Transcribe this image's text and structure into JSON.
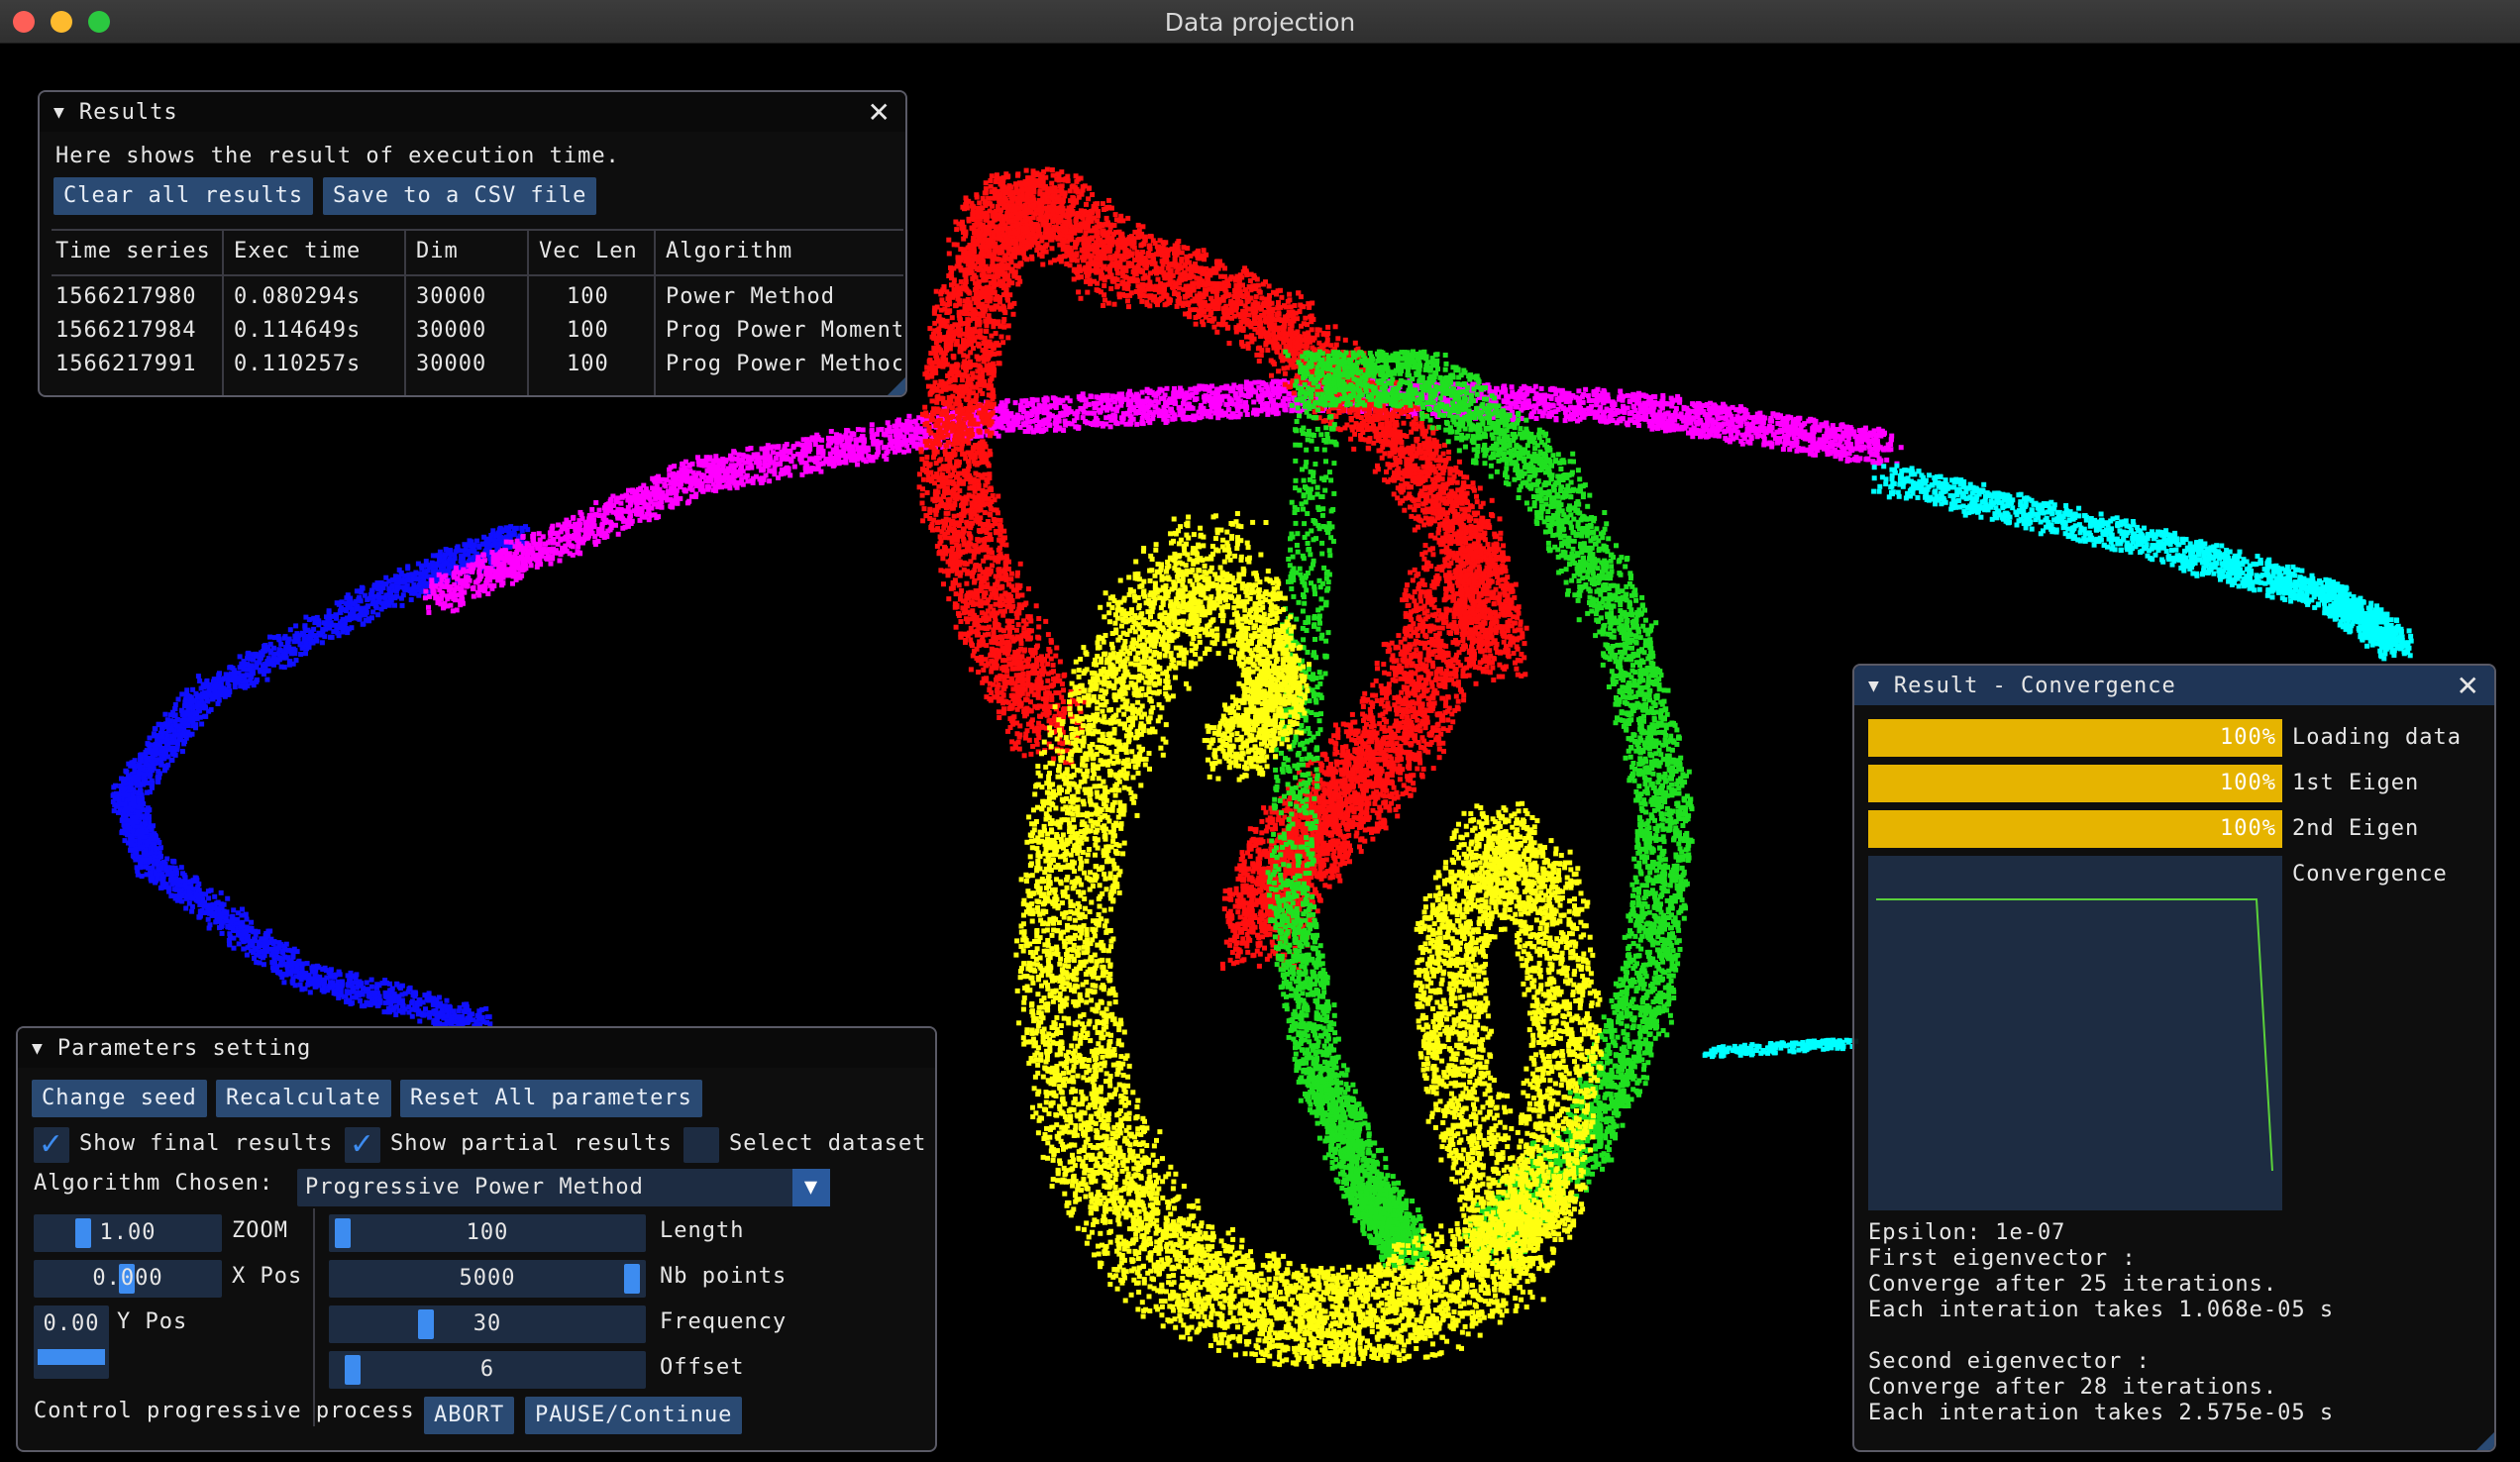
{
  "window": {
    "title": "Data projection"
  },
  "results": {
    "title": "Results",
    "description": "Here shows the result of execution time.",
    "clear_label": "Clear all results",
    "save_label": "Save to a CSV file",
    "columns": [
      "Time series",
      "Exec time",
      "Dim",
      "Vec Len",
      "Algorithm"
    ],
    "rows": [
      [
        "1566217980",
        "0.080294s",
        "30000",
        "100",
        "Power Method"
      ],
      [
        "1566217984",
        "0.114649s",
        "30000",
        "100",
        "Prog Power Moment"
      ],
      [
        "1566217991",
        "0.110257s",
        "30000",
        "100",
        "Prog Power Methoc"
      ]
    ]
  },
  "params": {
    "title": "Parameters setting",
    "change_seed": "Change seed",
    "recalculate": "Recalculate",
    "reset_all": "Reset All parameters",
    "show_final": "Show final results",
    "show_final_checked": true,
    "show_partial": "Show partial results",
    "show_partial_checked": true,
    "select_dataset": "Select dataset",
    "select_dataset_checked": false,
    "algorithm_label": "Algorithm Chosen:",
    "algorithm_value": "Progressive Power Method",
    "zoom_value": "1.00",
    "zoom_label": "ZOOM",
    "xpos_value": "0.000",
    "xpos_label": "X Pos",
    "ypos_value": "0.00",
    "ypos_label": "Y Pos",
    "length_value": "100",
    "length_label": "Length",
    "nbpoints_value": "5000",
    "nbpoints_label": "Nb points",
    "frequency_value": "30",
    "frequency_label": "Frequency",
    "offset_value": "6",
    "offset_label": "Offset",
    "control_label": "Control progressive process",
    "abort_label": "ABORT",
    "pause_label": "PAUSE/Continue"
  },
  "convergence": {
    "title": "Result - Convergence",
    "bars": [
      {
        "label": "Loading data",
        "text": "100%",
        "fraction": 1.0
      },
      {
        "label": "1st Eigen",
        "text": "100%",
        "fraction": 1.0
      },
      {
        "label": "2nd Eigen",
        "text": "100%",
        "fraction": 1.0
      }
    ],
    "plot_label": "Convergence",
    "lines": [
      "Epsilon: 1e-07",
      "First eigenvector :",
      "Converge after 25 iterations.",
      "Each interation takes 1.068e-05 s",
      "",
      "Second eigenvector :",
      "Converge after 28 iterations.",
      "Each interation takes 2.575e-05 s"
    ]
  },
  "colors": {
    "accent": "#3d8cf0",
    "button": "#2a4a73",
    "progress": "#e6b400",
    "plot_line": "#5ad13a",
    "red": "#ff1010",
    "green": "#20e020",
    "yellow": "#ffff10",
    "magenta": "#ff00ff",
    "blue": "#1010ff",
    "cyan": "#00ffff"
  }
}
